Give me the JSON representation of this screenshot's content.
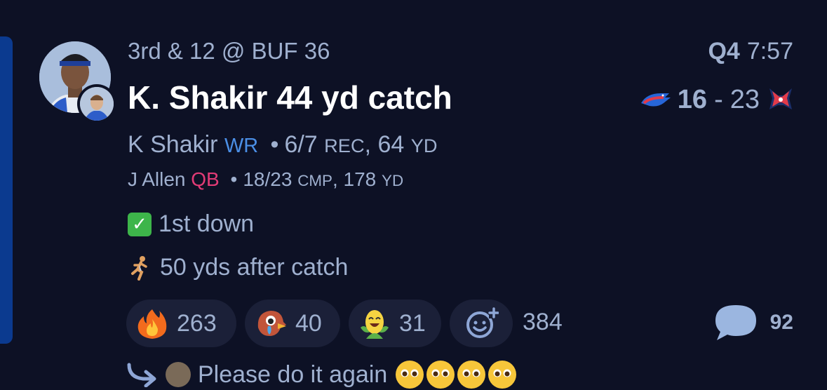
{
  "play": {
    "situation": "3rd & 12 @ BUF 36",
    "quarter": "Q4",
    "time": "7:57",
    "headline": "K. Shakir 44 yd catch"
  },
  "score": {
    "home_score": "16",
    "separator": "-",
    "away_score": "23",
    "home_logo": "bills-logo-icon",
    "away_logo": "texans-logo-icon"
  },
  "primary_player": {
    "name": "K Shakir",
    "position": "WR",
    "bullet": "•",
    "stat_value_1": "6/7",
    "stat_unit_1": "REC",
    "comma": ",",
    "stat_value_2": "64",
    "stat_unit_2": "YD"
  },
  "secondary_player": {
    "name": "J Allen",
    "position": "QB",
    "bullet": "•",
    "stat_value_1": "18/23",
    "stat_unit_1": "CMP",
    "comma": ",",
    "stat_value_2": "178",
    "stat_unit_2": "YD"
  },
  "tags": [
    {
      "icon": "check-mark-icon",
      "label": "1st down"
    },
    {
      "icon": "runner-icon",
      "label": "50 yds after catch"
    }
  ],
  "reactions": [
    {
      "icon": "fire-icon",
      "count": "263"
    },
    {
      "icon": "crying-bird-icon",
      "count": "40"
    },
    {
      "icon": "laughing-corn-icon",
      "count": "31"
    },
    {
      "icon": "add-reaction-icon",
      "count": "384"
    }
  ],
  "comments": {
    "icon": "speech-bubble-icon",
    "count": "92"
  },
  "reply_preview": {
    "text": "Please do it again"
  },
  "colors": {
    "background": "#0d1125",
    "accent_bar": "#0b3a8f",
    "wr_tag": "#4b8fe6",
    "qb_tag": "#e13b76",
    "pill": "#1b2038"
  }
}
